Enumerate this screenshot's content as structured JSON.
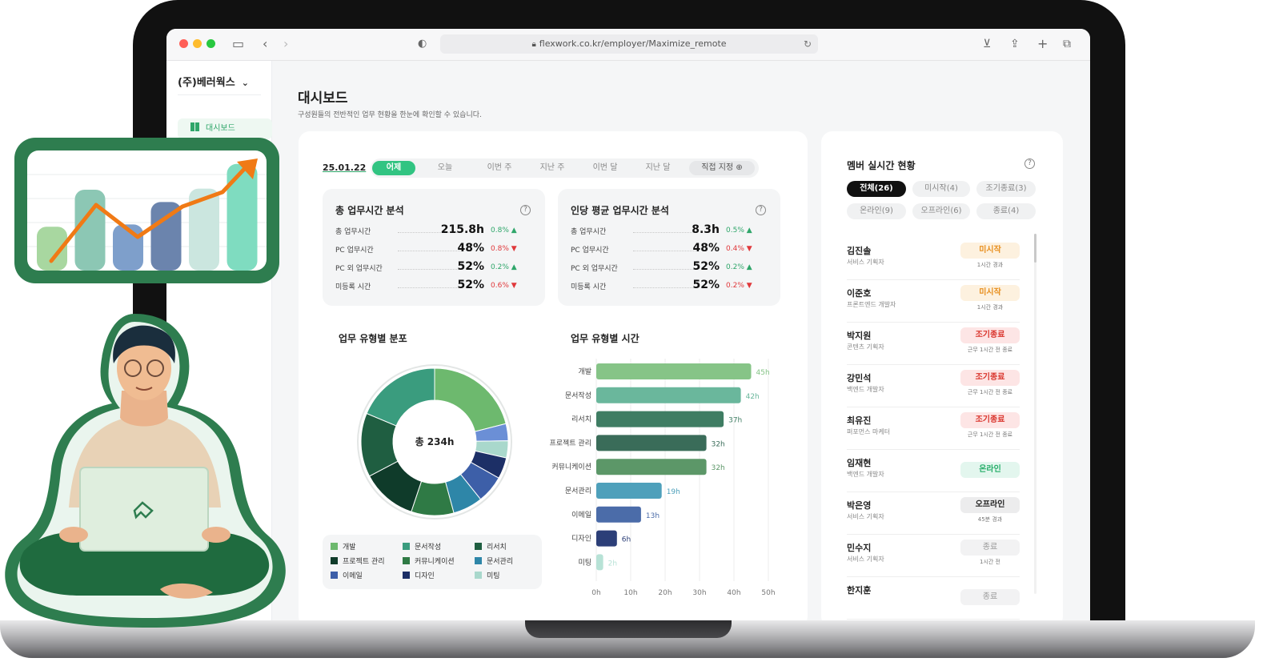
{
  "browser": {
    "url": "flexwork.co.kr/employer/Maximize_remote"
  },
  "sidebar": {
    "company": "(주)베러웍스",
    "items": [
      {
        "label": "대시보드",
        "active": true
      }
    ]
  },
  "header": {
    "title": "대시보드",
    "subtitle": "구성원들의 전반적인 업무 현황을 한눈에 확인할 수 있습니다."
  },
  "filter": {
    "date": "25.01.22",
    "options": [
      "어제",
      "오늘",
      "이번 주",
      "지난 주",
      "이번 달",
      "지난 달"
    ],
    "active": "어제",
    "custom_label": "직접 지정"
  },
  "total_analysis": {
    "title": "총 업무시간 분석",
    "rows": [
      {
        "label": "총 업무시간",
        "value": "215.8h",
        "change": "0.8%",
        "dir": "up"
      },
      {
        "label": "PC 업무시간",
        "value": "48%",
        "change": "0.8%",
        "dir": "down"
      },
      {
        "label": "PC 외 업무시간",
        "value": "52%",
        "change": "0.2%",
        "dir": "up"
      },
      {
        "label": "미등록 시간",
        "value": "52%",
        "change": "0.6%",
        "dir": "down"
      }
    ]
  },
  "avg_analysis": {
    "title": "인당 평균 업무시간 분석",
    "rows": [
      {
        "label": "총 업무시간",
        "value": "8.3h",
        "change": "0.5%",
        "dir": "up"
      },
      {
        "label": "PC 업무시간",
        "value": "48%",
        "change": "0.4%",
        "dir": "down"
      },
      {
        "label": "PC 외 업무시간",
        "value": "52%",
        "change": "0.2%",
        "dir": "up"
      },
      {
        "label": "미등록 시간",
        "value": "52%",
        "change": "0.2%",
        "dir": "down"
      }
    ]
  },
  "donut": {
    "title": "업무 유형별 분포",
    "center": "총 234h"
  },
  "bars_title": "업무 유형별 시간",
  "legend": [
    {
      "label": "개발",
      "color": "#6db96e"
    },
    {
      "label": "문서작성",
      "color": "#3a9c7e"
    },
    {
      "label": "리서치",
      "color": "#1f5e41"
    },
    {
      "label": "프로젝트 관리",
      "color": "#0f3b2a"
    },
    {
      "label": "커뮤니케이션",
      "color": "#2f7a45"
    },
    {
      "label": "문서관리",
      "color": "#2e86a8"
    },
    {
      "label": "이메일",
      "color": "#3d5fa8"
    },
    {
      "label": "디자인",
      "color": "#1c2f66"
    },
    {
      "label": "미팅",
      "color": "#a9d8cc"
    }
  ],
  "chart_data": [
    {
      "type": "pie",
      "title": "업무 유형별 분포",
      "categories": [
        "개발",
        "미등록",
        "미팅",
        "디자인",
        "이메일",
        "문서관리",
        "커뮤니케이션",
        "프로젝트 관리",
        "리서치",
        "문서작성"
      ],
      "values": [
        45,
        8,
        8,
        10,
        13,
        14,
        20,
        26,
        30,
        40
      ],
      "colors": [
        "#6db96e",
        "#6b8fd6",
        "#a9d8cc",
        "#1c2f66",
        "#3d5fa8",
        "#2e86a8",
        "#2f7a45",
        "#0f3b2a",
        "#1f5e41",
        "#3a9c7e"
      ],
      "center_label": "총 234h"
    },
    {
      "type": "bar",
      "title": "업무 유형별 시간",
      "categories": [
        "개발",
        "문서작성",
        "리서치",
        "프로젝트 관리",
        "커뮤니케이션",
        "문서관리",
        "이메일",
        "디자인",
        "미팅"
      ],
      "values": [
        45,
        42,
        37,
        32,
        32,
        19,
        13,
        6,
        2
      ],
      "value_labels": [
        "45h",
        "42h",
        "37h",
        "32h",
        "32h",
        "19h",
        "13h",
        "6h",
        "2h"
      ],
      "colors": [
        "#86c487",
        "#6ab79c",
        "#3f7d63",
        "#3a6c59",
        "#5c9768",
        "#4ea0bb",
        "#4b6ca9",
        "#2c3f78",
        "#b7e2d6"
      ],
      "xlim": [
        0,
        50
      ],
      "xticks": [
        "0h",
        "10h",
        "20h",
        "30h",
        "40h",
        "50h"
      ]
    }
  ],
  "members": {
    "title": "멤버 실시간 현황",
    "filters": [
      "전체(26)",
      "미시작(4)",
      "조기종료(3)",
      "온라인(9)",
      "오프라인(6)",
      "종료(4)"
    ],
    "list": [
      {
        "name": "김진솔",
        "role": "서비스 기획자",
        "status": "미시작",
        "note": "1시간 경과",
        "tone": "orange"
      },
      {
        "name": "이준호",
        "role": "프론트엔드 개발자",
        "status": "미시작",
        "note": "1시간 경과",
        "tone": "orange"
      },
      {
        "name": "박지원",
        "role": "콘텐츠 기획자",
        "status": "조기종료",
        "note": "근무 1시간 전 종료",
        "tone": "red"
      },
      {
        "name": "강민석",
        "role": "백엔드 개발자",
        "status": "조기종료",
        "note": "근무 1시간 전 종료",
        "tone": "red"
      },
      {
        "name": "최유진",
        "role": "퍼포먼스 마케터",
        "status": "조기종료",
        "note": "근무 1시간 전 종료",
        "tone": "red"
      },
      {
        "name": "임재현",
        "role": "백엔드 개발자",
        "status": "온라인",
        "note": "",
        "tone": "green"
      },
      {
        "name": "박은영",
        "role": "서비스 기획자",
        "status": "오프라인",
        "note": "45분 경과",
        "tone": "gray"
      },
      {
        "name": "민수지",
        "role": "서비스 기획자",
        "status": "종료",
        "note": "1시간 전",
        "tone": "light"
      },
      {
        "name": "한지훈",
        "role": "",
        "status": "종료",
        "note": "",
        "tone": "light"
      }
    ]
  },
  "illustration": {
    "chart_values": [
      0.32,
      0.65,
      0.34,
      0.54,
      0.66,
      0.88
    ]
  }
}
